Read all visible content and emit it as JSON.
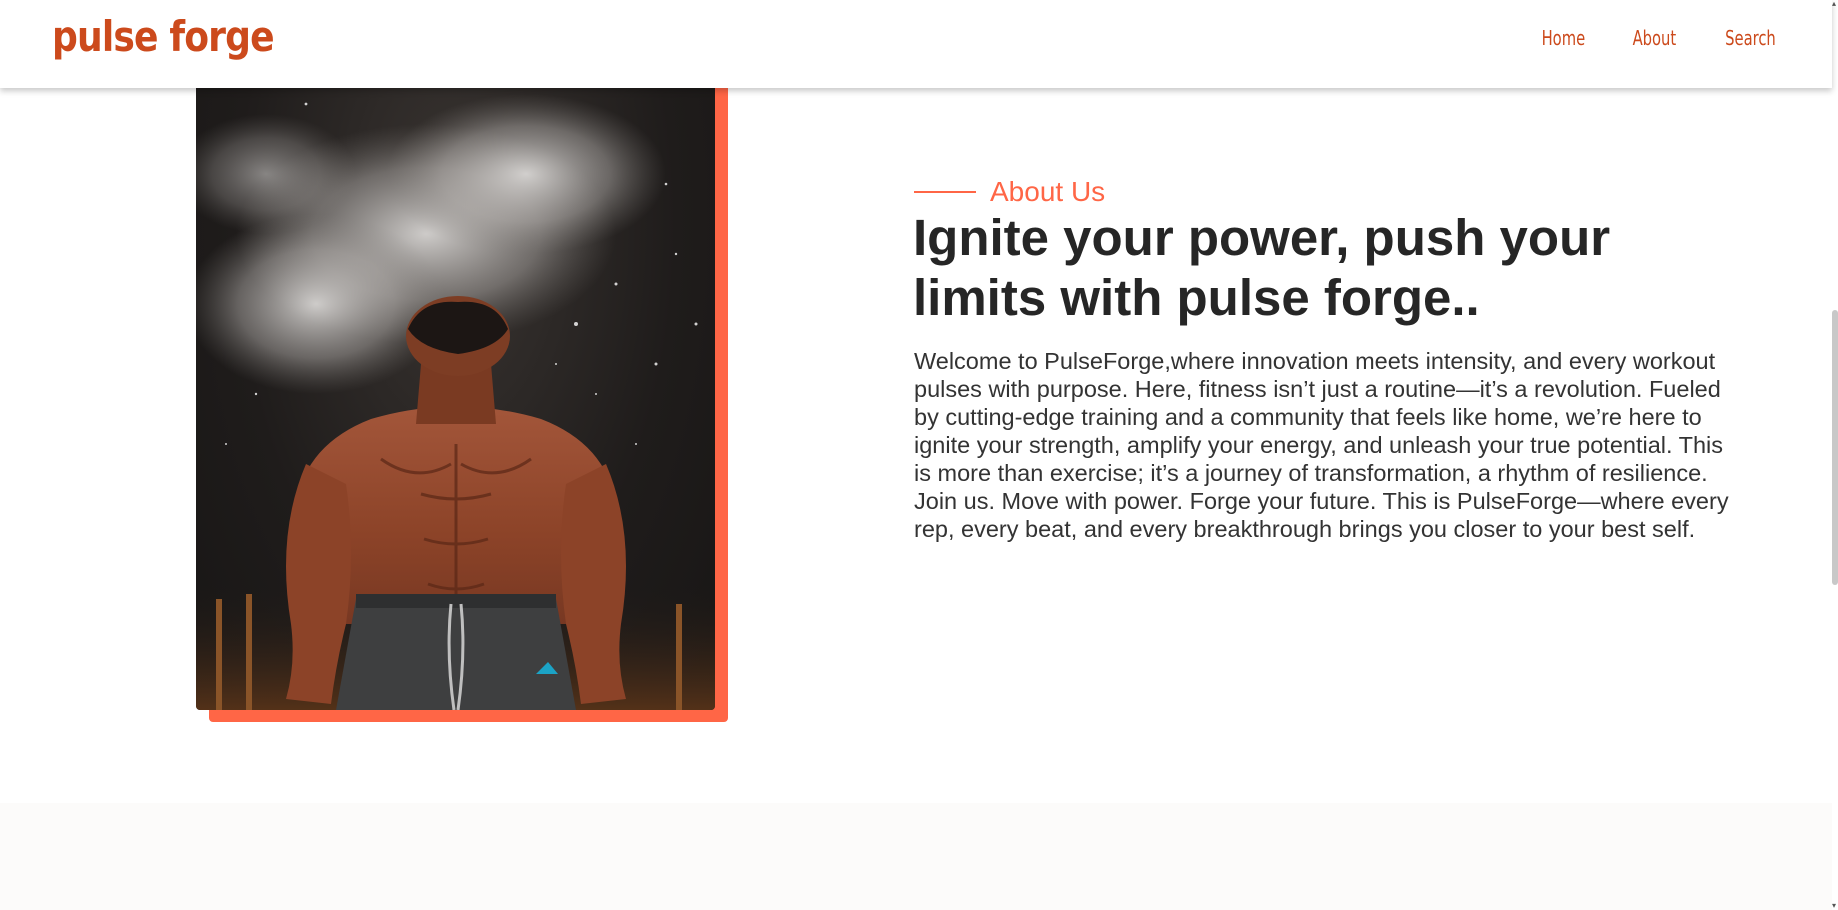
{
  "header": {
    "logo": "pulse forge",
    "nav": [
      {
        "label": "Home"
      },
      {
        "label": "About"
      },
      {
        "label": "Search"
      }
    ]
  },
  "about": {
    "eyebrow": "About Us",
    "heading": "Ignite your power, push your limits with pulse forge..",
    "body": "Welcome to PulseForge,where innovation meets intensity, and every workout pulses with purpose. Here, fitness isn’t just a routine—it’s a revolution. Fueled by cutting-edge training and a community that feels like home, we’re here to ignite your strength, amplify your energy, and unleash your true potential. This is more than exercise; it’s a journey of transformation, a rhythm of resilience. Join us. Move with power. Forge your future. This is PulseForge—where every rep, every beat, and every breakthrough brings you closer to your best self."
  },
  "colors": {
    "brand": "#cc4a1c",
    "accent": "#ff6646",
    "heading": "#262626",
    "body": "#333333"
  }
}
